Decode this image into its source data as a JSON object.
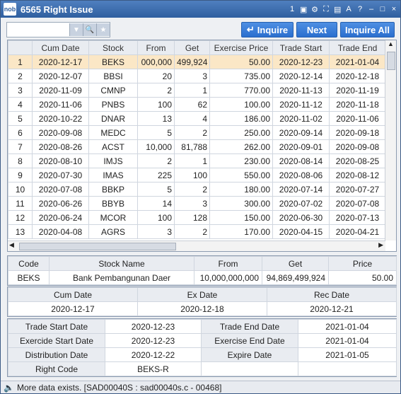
{
  "window": {
    "title": "6565 Right Issue",
    "logo_text": "nob",
    "icons": [
      "1",
      "▣",
      "⚙",
      "⛶",
      "▤",
      "A",
      "?",
      "–",
      "□",
      "×"
    ]
  },
  "toolbar": {
    "search_value": "",
    "inquire": "Inquire",
    "next": "Next",
    "inquire_all": "Inquire All"
  },
  "grid": {
    "headers": [
      "",
      "Cum Date",
      "Stock",
      "From",
      "Get",
      "Exercise Price",
      "Trade Start",
      "Trade End"
    ],
    "rows": [
      [
        "1",
        "2020-12-17",
        "BEKS",
        "000,000",
        "499,924",
        "50.00",
        "2020-12-23",
        "2021-01-04"
      ],
      [
        "2",
        "2020-12-07",
        "BBSI",
        "20",
        "3",
        "735.00",
        "2020-12-14",
        "2020-12-18"
      ],
      [
        "3",
        "2020-11-09",
        "CMNP",
        "2",
        "1",
        "770.00",
        "2020-11-13",
        "2020-11-19"
      ],
      [
        "4",
        "2020-11-06",
        "PNBS",
        "100",
        "62",
        "100.00",
        "2020-11-12",
        "2020-11-18"
      ],
      [
        "5",
        "2020-10-22",
        "DNAR",
        "13",
        "4",
        "186.00",
        "2020-11-02",
        "2020-11-06"
      ],
      [
        "6",
        "2020-09-08",
        "MEDC",
        "5",
        "2",
        "250.00",
        "2020-09-14",
        "2020-09-18"
      ],
      [
        "7",
        "2020-08-26",
        "ACST",
        "10,000",
        "81,788",
        "262.00",
        "2020-09-01",
        "2020-09-08"
      ],
      [
        "8",
        "2020-08-10",
        "IMJS",
        "2",
        "1",
        "230.00",
        "2020-08-14",
        "2020-08-25"
      ],
      [
        "9",
        "2020-07-30",
        "IMAS",
        "225",
        "100",
        "550.00",
        "2020-08-06",
        "2020-08-12"
      ],
      [
        "10",
        "2020-07-08",
        "BBKP",
        "5",
        "2",
        "180.00",
        "2020-07-14",
        "2020-07-27"
      ],
      [
        "11",
        "2020-06-26",
        "BBYB",
        "14",
        "3",
        "300.00",
        "2020-07-02",
        "2020-07-08"
      ],
      [
        "12",
        "2020-06-24",
        "MCOR",
        "100",
        "128",
        "150.00",
        "2020-06-30",
        "2020-07-13"
      ],
      [
        "13",
        "2020-04-08",
        "AGRS",
        "3",
        "2",
        "170.00",
        "2020-04-15",
        "2020-04-21"
      ]
    ]
  },
  "detail": {
    "headers": [
      "Code",
      "Stock Name",
      "From",
      "Get",
      "Price"
    ],
    "values": [
      "BEKS",
      "Bank Pembangunan Daer",
      "10,000,000,000",
      "94,869,499,924",
      "50.00"
    ]
  },
  "dates": {
    "headers": [
      "Cum Date",
      "Ex Date",
      "Rec Date"
    ],
    "values": [
      "2020-12-17",
      "2020-12-18",
      "2020-12-21"
    ]
  },
  "info": {
    "trade_start_label": "Trade Start Date",
    "trade_start": "2020-12-23",
    "trade_end_label": "Trade End Date",
    "trade_end": "2021-01-04",
    "exercise_start_label": "Exercide Start Date",
    "exercise_start": "2020-12-23",
    "exercise_end_label": "Exercise End Date",
    "exercise_end": "2021-01-04",
    "distribution_label": "Distribution Date",
    "distribution": "2020-12-22",
    "expire_label": "Expire Date",
    "expire": "2021-01-05",
    "right_code_label": "Right Code",
    "right_code": "BEKS-R"
  },
  "status": {
    "message": "More data exists. [SAD00040S : sad00040s.c - 00468]"
  }
}
